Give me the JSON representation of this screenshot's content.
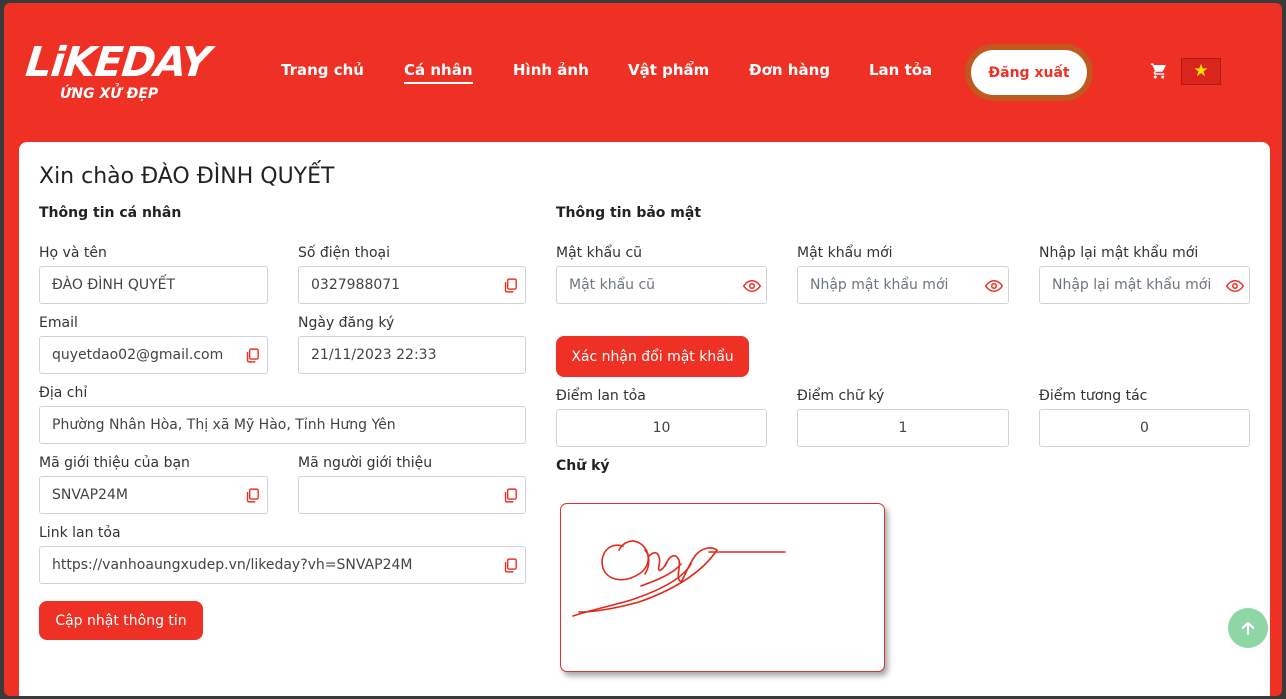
{
  "logo": {
    "main": "LiKEDAY",
    "sub": "ỨNG XỬ ĐẸP"
  },
  "nav": {
    "items": [
      "Trang chủ",
      "Cá nhân",
      "Hình ảnh",
      "Vật phẩm",
      "Đơn hàng",
      "Lan tỏa"
    ],
    "active": "Cá nhân",
    "logout_label": "Đăng xuất",
    "cart_icon": "cart-icon",
    "flag_icon": "vietnam-flag-icon"
  },
  "greeting": "Xin chào ĐÀO ĐÌNH QUYẾT",
  "personal": {
    "title": "Thông tin cá nhân",
    "full_name_label": "Họ và tên",
    "full_name": "ĐÀO ĐÌNH QUYẾT",
    "phone_label": "Số điện thoại",
    "phone": "0327988071",
    "email_label": "Email",
    "email": "quyetdao02@gmail.com",
    "register_date_label": "Ngày đăng ký",
    "register_date": "21/11/2023 22:33",
    "address_label": "Địa chỉ",
    "address": "Phường Nhân Hòa, Thị xã Mỹ Hào, Tỉnh Hưng Yên",
    "ref_code_label": "Mã giới thiệu của bạn",
    "ref_code": "SNVAP24M",
    "referrer_label": "Mã người giới thiệu",
    "referrer": "",
    "link_label": "Link lan tỏa",
    "link": "https://vanhoaungxudep.vn/likeday?vh=SNVAP24M",
    "update_button": "Cập nhật thông tin"
  },
  "security": {
    "title": "Thông tin bảo mật",
    "old_pw_label": "Mật khẩu cũ",
    "old_pw_placeholder": "Mật khẩu cũ",
    "new_pw_label": "Mật khẩu mới",
    "new_pw_placeholder": "Nhập mật khẩu mới",
    "confirm_pw_label": "Nhập lại mật khẩu mới",
    "confirm_pw_placeholder": "Nhập lại mật khẩu mới",
    "confirm_button": "Xác nhận đổi mật khẩu"
  },
  "stats": {
    "spread_label": "Điểm lan tỏa",
    "spread": "10",
    "signature_points_label": "Điểm chữ ký",
    "signature_points": "1",
    "interaction_label": "Điểm tương tác",
    "interaction": "0"
  },
  "signature": {
    "label": "Chữ ký"
  },
  "colors": {
    "brand": "#ee3124",
    "scroll_top": "#8fd6a7"
  }
}
